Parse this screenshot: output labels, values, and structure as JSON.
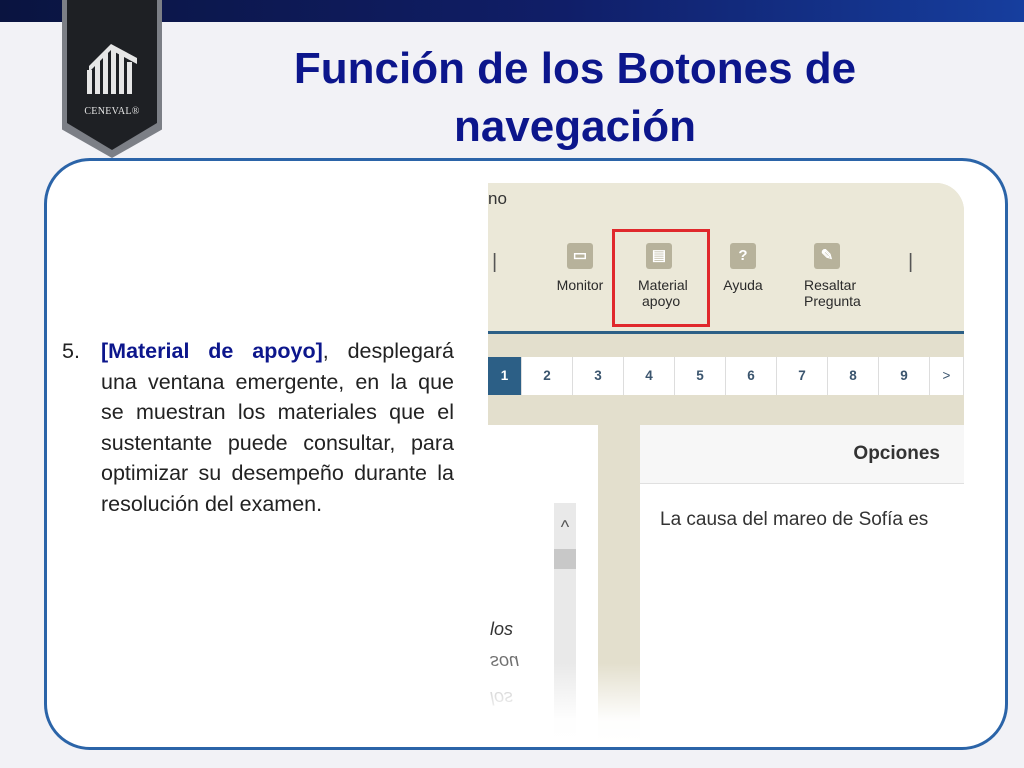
{
  "slide": {
    "title": "Función de los Botones de navegación",
    "logo_text": "CENEVAL®",
    "item_number": "5.",
    "item_keyword": "[Material de apoyo]",
    "item_text": ", desplegará una ventana emergente, en la que se muestran los materiales que el sustentante puede consultar, para optimizar su desempeño durante la resolución del examen."
  },
  "screenshot": {
    "menu_text": "no",
    "separator": "|",
    "toolbar_buttons": [
      {
        "label_line1": "Monitor",
        "label_line2": "",
        "icon": "monitor-icon",
        "glyph": "▭"
      },
      {
        "label_line1": "Material",
        "label_line2": "apoyo",
        "icon": "document-icon",
        "glyph": "▤"
      },
      {
        "label_line1": "Ayuda",
        "label_line2": "",
        "icon": "help-icon",
        "glyph": "?"
      },
      {
        "label_line1": "Resaltar",
        "label_line2": "Pregunta",
        "icon": "highlighter-icon",
        "glyph": "✎"
      }
    ],
    "pages": [
      "1",
      "2",
      "3",
      "4",
      "5",
      "6",
      "7",
      "8",
      "9",
      ">"
    ],
    "active_page": "1",
    "scroll_up_glyph": "^",
    "left_words": [
      "los",
      "sou",
      "los"
    ],
    "panel_title": "Opciones",
    "question_text": "La causa del mareo de Sofía es",
    "colors": {
      "highlight": "#e0282c",
      "accent": "#2c5f86",
      "title": "#0c168c"
    }
  }
}
